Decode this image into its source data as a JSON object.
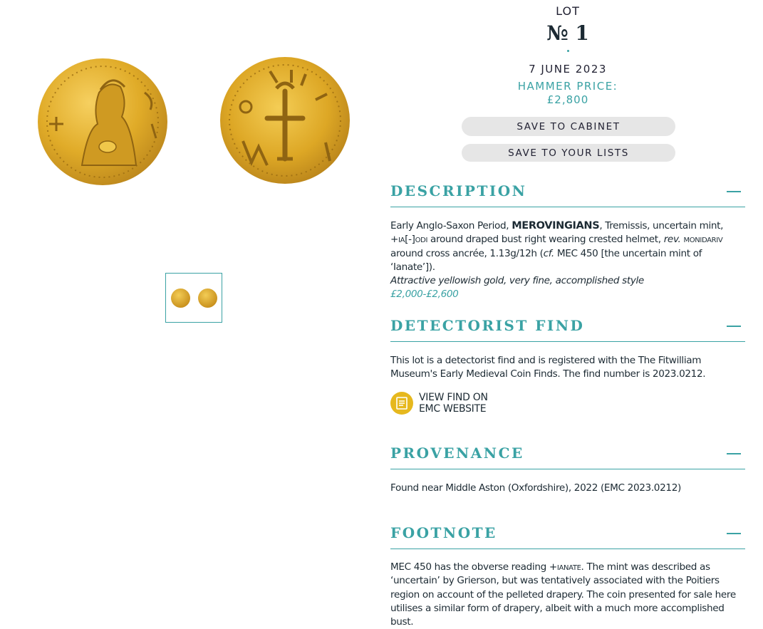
{
  "gallery": {
    "obverse_alt": "coin obverse",
    "reverse_alt": "coin reverse"
  },
  "lot": {
    "label": "LOT",
    "number": "№ 1",
    "date": "7 JUNE 2023",
    "hammer_label": "HAMMER PRICE:",
    "hammer_price": "£2,800"
  },
  "actions": {
    "save_cabinet": "SAVE TO CABINET",
    "save_lists": "SAVE TO YOUR LISTS"
  },
  "description": {
    "title": "DESCRIPTION",
    "intro": "Early Anglo-Saxon Period, ",
    "ruler": "MEROVINGIANS",
    "after_ruler": ", Tremissis, uncertain mint,",
    "legend_obv": "+ia[-]odi",
    "line2": " around draped bust right wearing crested helmet, ",
    "rev_abbr": "rev.",
    "legend_rev": " monidariv",
    "line3_a": "around cross ancrée, 1.13g/12h (",
    "cf": "cf.",
    "line3_b": " MEC 450 [the uncertain mint of ‘Ianate’]).",
    "condition": "Attractive yellowish gold, very fine, accomplished style",
    "estimate": "£2,000-£2,600"
  },
  "detectorist": {
    "title": "DETECTORIST FIND",
    "text": "This lot is a detectorist find and is registered with the The Fitwilliam Museum's Early Medieval Coin Finds. The find number is 2023.0212.",
    "link_line1": "VIEW FIND ON",
    "link_line2": "EMC WEBSITE",
    "icon": "document-icon",
    "icon_color": "#e6b81e"
  },
  "provenance": {
    "title": "PROVENANCE",
    "text": "Found near Middle Aston (Oxfordshire), 2022 (EMC 2023.0212)"
  },
  "footnote": {
    "title": "FOOTNOTE",
    "a": "MEC 450 has the obverse reading ",
    "legend": "+ianate",
    "b": ". The mint was described as ‘uncertain’ by Grierson, but was tentatively associated with the Poitiers region on account of the pelleted drapery. The coin presented for sale here utilises a similar form of drapery, albeit with a much more accomplished bust."
  },
  "colors": {
    "accent": "#3aa2a4",
    "text": "#1c2a33",
    "pill_bg": "#e6e6e6",
    "gold": "#e0ab28"
  }
}
